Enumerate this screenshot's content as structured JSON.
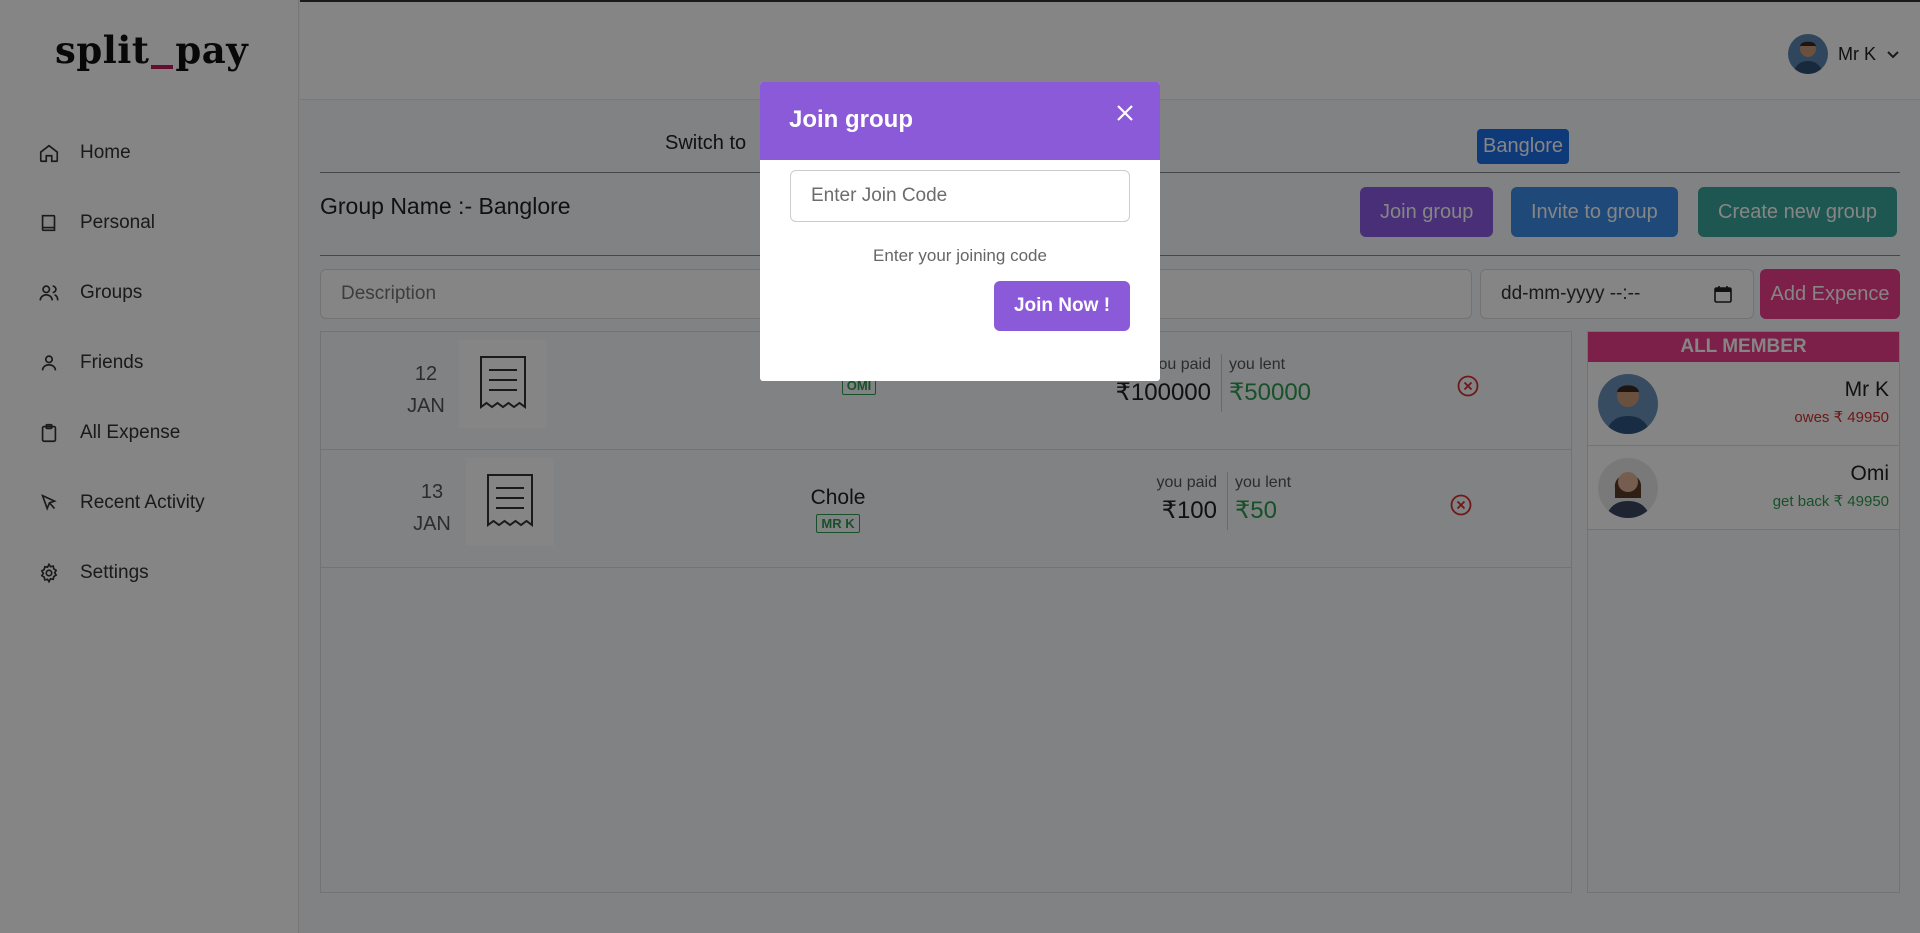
{
  "brand": {
    "part1": "split",
    "part2": "pay"
  },
  "sidebar": {
    "items": [
      {
        "label": "Home",
        "icon": "home-icon"
      },
      {
        "label": "Personal",
        "icon": "book-icon"
      },
      {
        "label": "Groups",
        "icon": "users-icon"
      },
      {
        "label": "Friends",
        "icon": "user-icon"
      },
      {
        "label": "All Expense",
        "icon": "clipboard-icon"
      },
      {
        "label": "Recent Activity",
        "icon": "cursor-icon"
      },
      {
        "label": "Settings",
        "icon": "gear-icon"
      }
    ]
  },
  "header": {
    "user_name": "Mr K"
  },
  "main": {
    "switch_label": "Switch to",
    "current_group_pill": "Banglore",
    "group_title": "Group Name :- Banglore",
    "buttons": {
      "join": "Join group",
      "invite": "Invite to group",
      "create": "Create new group"
    },
    "description_placeholder": "Description",
    "date_placeholder": "dd-mm-yyyy --:--",
    "add_button": "Add Expence"
  },
  "expenses": [
    {
      "day": "12",
      "month": "JAN",
      "name": "",
      "tag": "OMI",
      "paid_label": "you paid",
      "paid": "₹100000",
      "lent_label": "you lent",
      "lent": "₹50000"
    },
    {
      "day": "13",
      "month": "JAN",
      "name": "Chole",
      "tag": "MR K",
      "paid_label": "you paid",
      "paid": "₹100",
      "lent_label": "you lent",
      "lent": "₹50"
    }
  ],
  "members": {
    "title": "ALL MEMBER",
    "list": [
      {
        "name": "Mr K",
        "status": "owes ₹ 49950",
        "kind": "owes"
      },
      {
        "name": "Omi",
        "status": "get back ₹ 49950",
        "kind": "back"
      }
    ]
  },
  "modal": {
    "title": "Join group",
    "input_placeholder": "Enter Join Code",
    "hint": "Enter your joining code",
    "submit": "Join Now !"
  },
  "colors": {
    "accent": "#8b5ad9",
    "pink": "#ee3d8c",
    "blue": "#1b6fe8",
    "teal": "#3aa89c",
    "green": "#2e9c4f",
    "red": "#d32f2f"
  }
}
